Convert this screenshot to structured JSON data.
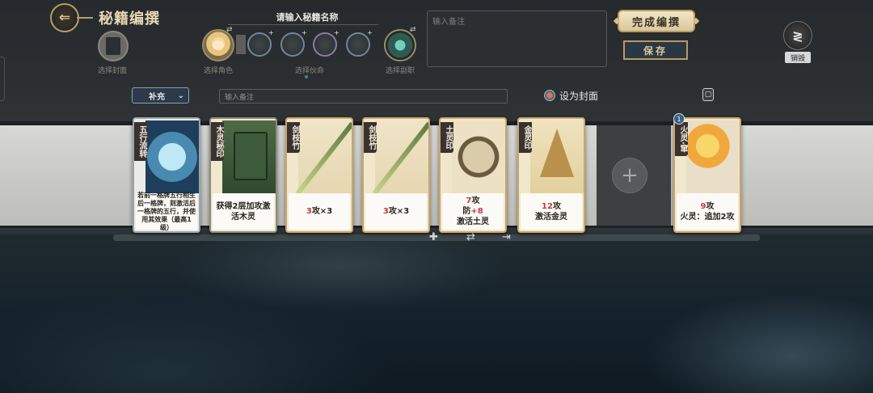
{
  "header": {
    "title": "秘籍编撰",
    "name_prompt": "请输入秘籍名称",
    "choose_cover": "选择封面",
    "choose_role": "选择角色",
    "choose_life": "选择伙命",
    "choose_job": "选择副职",
    "note_placeholder": "输入备注",
    "finish_label": "完成编撰",
    "save_label": "保存",
    "destroy_label": "销毁",
    "destroy_glyph": "≷"
  },
  "toolbar": {
    "category": "补充",
    "note_placeholder": "输入备注",
    "cover_label": "设为封面"
  },
  "cards": [
    {
      "name": "五行流转",
      "desc": "若前一格牌五行相生后一格牌，则激活后一格牌的五行，并使用其效果（最高1级）",
      "art": "art-wuxing",
      "style": "grey"
    },
    {
      "name": "木灵秘印",
      "desc": "获得2层加攻激活木灵",
      "art": "art-mu",
      "style": "dark"
    },
    {
      "name": "剑枝竹",
      "desc_num": "3",
      "desc_rest": "攻×3",
      "art": "art-sword",
      "style": "gold"
    },
    {
      "name": "剑枝竹",
      "desc_num": "3",
      "desc_rest": "攻×3",
      "art": "art-sword",
      "style": "gold"
    },
    {
      "name": "土灵印",
      "line1_num": "7",
      "line1": "攻",
      "line2": "防",
      "line2_num": "+8",
      "line3": "激活土灵",
      "art": "art-tu",
      "style": "gold"
    },
    {
      "name": "金灵印",
      "line1_num": "12",
      "line1": "攻",
      "line2": "激活金灵",
      "art": "art-jin",
      "style": "gold"
    },
    {
      "name": "火灵·窜",
      "line1_num": "9",
      "line1": "攻",
      "line2": "火灵：追加2攻",
      "art": "art-huo",
      "style": "gold",
      "level": "1"
    }
  ],
  "actions": {
    "add": "✚",
    "swap": "⇄",
    "remove": "⇥"
  },
  "icons": [
    "back-arrow-icon",
    "swap-icon",
    "plus-icon",
    "chevron-down-icon",
    "document-icon",
    "destroy-icon",
    "add-card-icon"
  ]
}
